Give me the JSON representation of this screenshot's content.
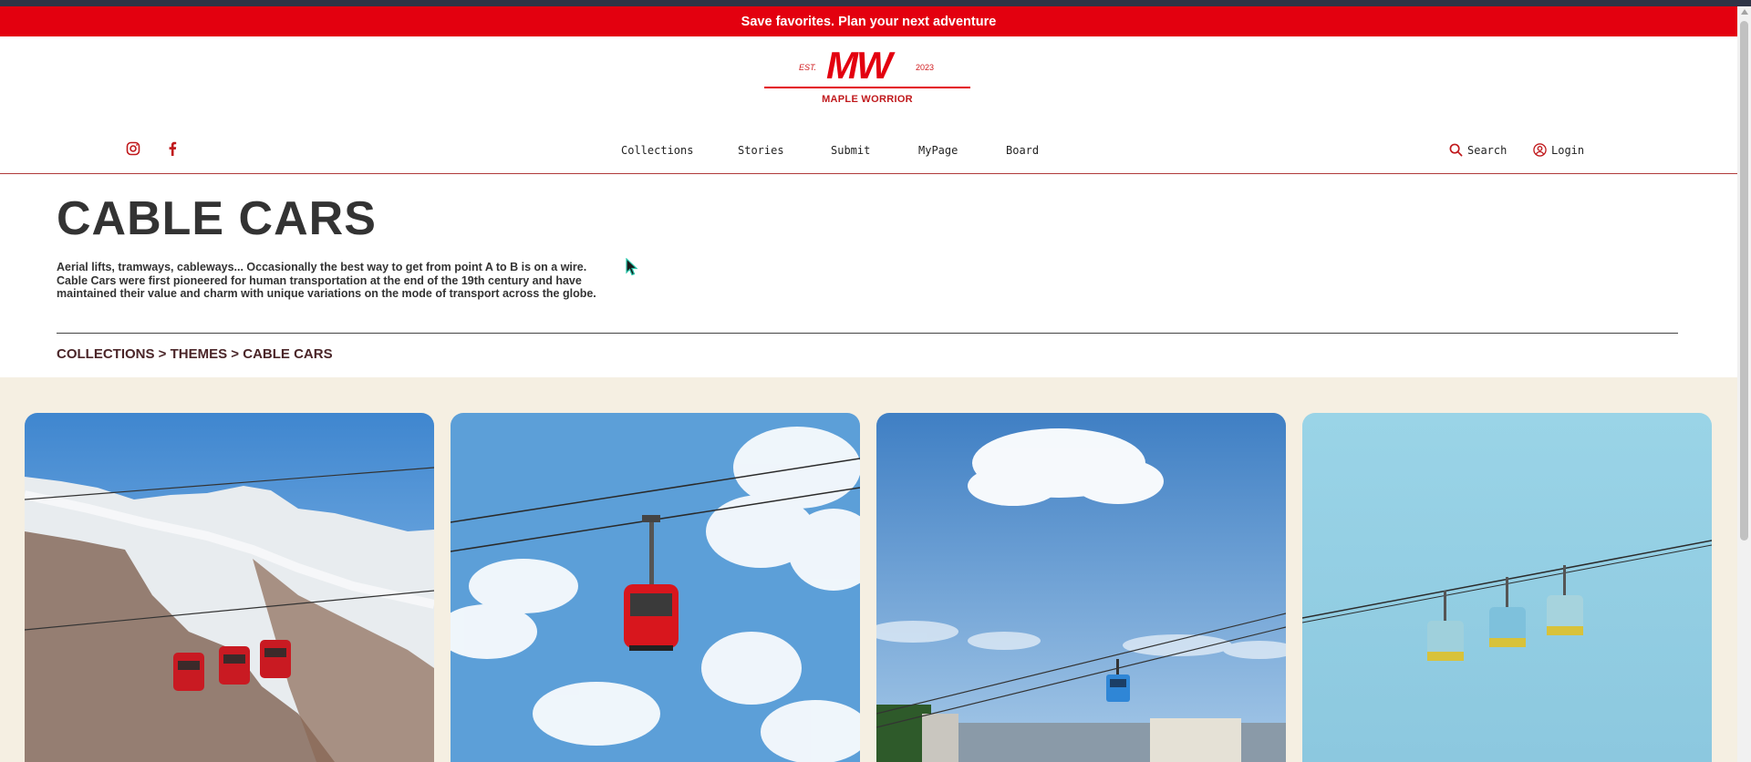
{
  "promo_banner": {
    "text": "Save favorites. Plan your next adventure"
  },
  "brand": {
    "est": "EST.",
    "year": "2023",
    "monogram": "MW",
    "name": "MAPLE WORRIOR",
    "color": "#e3000f"
  },
  "social": [
    {
      "icon": "instagram-icon"
    },
    {
      "icon": "facebook-icon"
    }
  ],
  "nav": {
    "items": [
      "Collections",
      "Stories",
      "Submit",
      "MyPage",
      "Board"
    ]
  },
  "utility": {
    "search_label": "Search",
    "login_label": "Login"
  },
  "page": {
    "title": "CABLE CARS",
    "description": "Aerial lifts, tramways, cableways... Occasionally the best way to get from point A to B is on a wire. Cable Cars were first pioneered for human transportation at the end of the 19th century and have maintained their value and charm with unique variations on the mode of transport across the globe."
  },
  "breadcrumb": {
    "items": [
      "COLLECTIONS",
      "THEMES",
      "CABLE CARS"
    ],
    "separator": ">"
  },
  "colors": {
    "accent": "#e3000f",
    "gallery_bg": "#f5efe2",
    "text_dark": "#333333"
  },
  "gallery": {
    "cards": [
      {
        "subject": "three red gondolas over snowy mountains"
      },
      {
        "subject": "single red gondola against cloudy sky"
      },
      {
        "subject": "blue gondola above city"
      },
      {
        "subject": "three yellow and blue gondolas on cable"
      }
    ]
  }
}
